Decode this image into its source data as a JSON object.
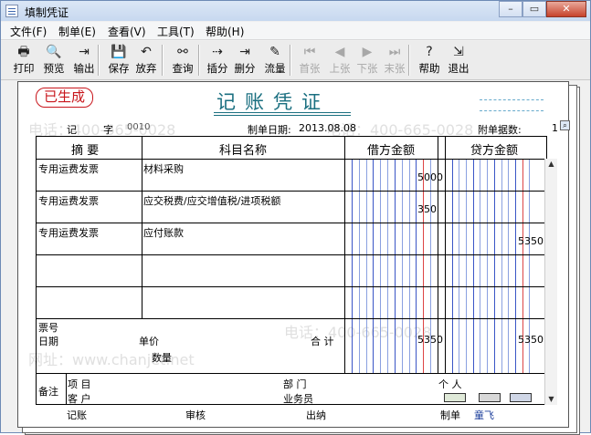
{
  "window": {
    "title": "填制凭证"
  },
  "menu": [
    "文件(F)",
    "制单(E)",
    "查看(V)",
    "工具(T)",
    "帮助(H)"
  ],
  "toolbar": [
    {
      "label": "打印",
      "icon": "printer-icon",
      "glyph": "🖶",
      "enabled": true
    },
    {
      "label": "预览",
      "icon": "preview-icon",
      "glyph": "🔍",
      "enabled": true
    },
    {
      "label": "输出",
      "icon": "export-icon",
      "glyph": "⇥",
      "enabled": true
    },
    {
      "label": "保存",
      "icon": "save-icon",
      "glyph": "💾",
      "enabled": true
    },
    {
      "label": "放弃",
      "icon": "undo-icon",
      "glyph": "↶",
      "enabled": true
    },
    {
      "label": "查询",
      "icon": "binoculars-icon",
      "glyph": "⚯",
      "enabled": true
    },
    {
      "label": "插分",
      "icon": "insert-row-icon",
      "glyph": "⇢",
      "enabled": true
    },
    {
      "label": "删分",
      "icon": "delete-row-icon",
      "glyph": "⇥",
      "enabled": true
    },
    {
      "label": "流量",
      "icon": "flow-icon",
      "glyph": "✎",
      "enabled": true
    },
    {
      "label": "首张",
      "icon": "first-icon",
      "glyph": "⏮",
      "enabled": false
    },
    {
      "label": "上张",
      "icon": "prev-icon",
      "glyph": "◀",
      "enabled": false
    },
    {
      "label": "下张",
      "icon": "next-icon",
      "glyph": "▶",
      "enabled": false
    },
    {
      "label": "末张",
      "icon": "last-icon",
      "glyph": "⏭",
      "enabled": false
    },
    {
      "label": "帮助",
      "icon": "help-icon",
      "glyph": "?",
      "enabled": true
    },
    {
      "label": "退出",
      "icon": "exit-icon",
      "glyph": "⇲",
      "enabled": true
    }
  ],
  "voucher": {
    "stamp": "已生成",
    "title": "记账凭证",
    "type_label": "记",
    "type_char": "字",
    "number": "0010",
    "date_label": "制单日期:",
    "date": "2013.08.08",
    "attach_label": "附单据数:",
    "attach_count": "1",
    "headers": {
      "summary": "摘 要",
      "account": "科目名称",
      "debit": "借方金额",
      "credit": "贷方金额"
    },
    "rows": [
      {
        "summary": "专用运费发票",
        "account": "材料采购",
        "debit": "5000",
        "credit": ""
      },
      {
        "summary": "专用运费发票",
        "account": "应交税费/应交增值税/进项税额",
        "debit": "350",
        "credit": ""
      },
      {
        "summary": "专用运费发票",
        "account": "应付账款",
        "debit": "",
        "credit": "5350"
      },
      {
        "summary": "",
        "account": "",
        "debit": "",
        "credit": ""
      },
      {
        "summary": "",
        "account": "",
        "debit": "",
        "credit": ""
      }
    ],
    "footer": {
      "ticket_no": "票号",
      "ticket_date": "日期",
      "unit_price": "单价",
      "quantity": "数量",
      "total_label": "合 计",
      "total_debit": "5350",
      "total_credit": "5350",
      "remark": "备注",
      "project_label": "项 目",
      "customer_label": "客 户",
      "dept_label": "部 门",
      "clerk_label": "业务员",
      "person_label": "个 人"
    },
    "signoff": {
      "bookkeeping": "记账",
      "audit": "审核",
      "cashier": "出纳",
      "maker_label": "制单",
      "maker": "童飞"
    }
  },
  "watermark": {
    "phone": "电话：400-665-0028",
    "site": "网址：www.chanjet.net"
  }
}
